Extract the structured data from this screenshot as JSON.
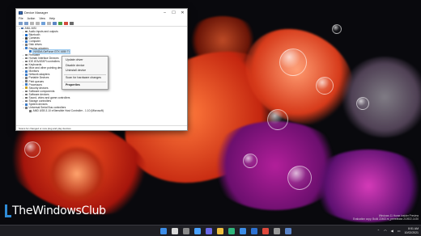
{
  "window": {
    "title": "Device Manager",
    "menu": [
      "File",
      "Action",
      "View",
      "Help"
    ],
    "controls": {
      "minimize": "–",
      "maximize": "☐",
      "close": "✕"
    },
    "statusbar": "Scans for changed or new plug and play devices."
  },
  "tree": [
    {
      "label": "ANIL-MSI",
      "level": 0,
      "chev": "⌄",
      "color": "#4a6fa5"
    },
    {
      "label": "Audio inputs and outputs",
      "level": 1,
      "chev": "›",
      "color": "#6d6d6d"
    },
    {
      "label": "Bluetooth",
      "level": 1,
      "chev": "›",
      "color": "#1d6fd0"
    },
    {
      "label": "Cameras",
      "level": 1,
      "chev": "›",
      "color": "#444444"
    },
    {
      "label": "Computer",
      "level": 1,
      "chev": "›",
      "color": "#3a7bc8"
    },
    {
      "label": "Disk drives",
      "level": 1,
      "chev": "›",
      "color": "#7a7a7a"
    },
    {
      "label": "Display adapters",
      "level": 1,
      "chev": "⌄",
      "color": "#3a7bc8"
    },
    {
      "label": "NVIDIA GeForce GTX 1650 Ti",
      "level": 2,
      "chev": "",
      "color": "#3a7bc8",
      "selected": true
    },
    {
      "label": "Firmware",
      "level": 1,
      "chev": "›",
      "color": "#7a7a7a"
    },
    {
      "label": "Human Interface Devices",
      "level": 1,
      "chev": "›",
      "color": "#7a7a7a"
    },
    {
      "label": "IDE ATA/ATAPI controllers",
      "level": 1,
      "chev": "›",
      "color": "#7a7a7a"
    },
    {
      "label": "Keyboards",
      "level": 1,
      "chev": "›",
      "color": "#7a7a7a"
    },
    {
      "label": "Mice and other pointing devices",
      "level": 1,
      "chev": "›",
      "color": "#7a7a7a"
    },
    {
      "label": "Monitors",
      "level": 1,
      "chev": "›",
      "color": "#3a7bc8"
    },
    {
      "label": "Network adapters",
      "level": 1,
      "chev": "›",
      "color": "#3a7bc8"
    },
    {
      "label": "Portable Devices",
      "level": 1,
      "chev": "›",
      "color": "#7a7a7a"
    },
    {
      "label": "Print queues",
      "level": 1,
      "chev": "›",
      "color": "#7a7a7a"
    },
    {
      "label": "Processors",
      "level": 1,
      "chev": "›",
      "color": "#3a7bc8"
    },
    {
      "label": "Security devices",
      "level": 1,
      "chev": "›",
      "color": "#c9a227"
    },
    {
      "label": "Software components",
      "level": 1,
      "chev": "›",
      "color": "#7a7a7a"
    },
    {
      "label": "Software devices",
      "level": 1,
      "chev": "›",
      "color": "#7a7a7a"
    },
    {
      "label": "Sound, video and game controllers",
      "level": 1,
      "chev": "›",
      "color": "#6d6d6d"
    },
    {
      "label": "Storage controllers",
      "level": 1,
      "chev": "›",
      "color": "#7a7a7a"
    },
    {
      "label": "System devices",
      "level": 1,
      "chev": "›",
      "color": "#3a7bc8"
    },
    {
      "label": "Universal Serial Bus controllers",
      "level": 1,
      "chev": "⌄",
      "color": "#7a7a7a"
    },
    {
      "label": "AMD USB 3.10 eXtensible Host Controller - 1.10 (Microsoft)",
      "level": 2,
      "chev": "",
      "color": "#7a7a7a"
    }
  ],
  "context_menu": {
    "items": [
      "Update driver",
      "Disable device",
      "Uninstall device"
    ],
    "scan": "Scan for hardware changes",
    "properties": "Properties"
  },
  "watermark": {
    "line1": "Windows 11 Home Insider Preview",
    "line2": "Evaluation copy. Build 22463.rs_prerelease.210922-1430"
  },
  "brand": "TheWindowsClub",
  "taskbar": {
    "icons": [
      {
        "name": "start-icon",
        "color": "#3d8ee8"
      },
      {
        "name": "search-icon",
        "color": "#d9d9d9"
      },
      {
        "name": "task-view-icon",
        "color": "#8a8a8a"
      },
      {
        "name": "widgets-icon",
        "color": "#4aa2ff"
      },
      {
        "name": "chat-icon",
        "color": "#6a6ae8"
      },
      {
        "name": "file-explorer-icon",
        "color": "#f0c040"
      },
      {
        "name": "edge-icon",
        "color": "#2fb67c"
      },
      {
        "name": "store-icon",
        "color": "#3d8ee8"
      },
      {
        "name": "mail-icon",
        "color": "#2d72d2"
      },
      {
        "name": "chrome-icon",
        "color": "#e0493c"
      },
      {
        "name": "settings-icon",
        "color": "#9a9a9a"
      },
      {
        "name": "device-manager-icon",
        "color": "#5a84c8"
      }
    ],
    "time": "8:51 AM",
    "date": "10/02/2021"
  }
}
